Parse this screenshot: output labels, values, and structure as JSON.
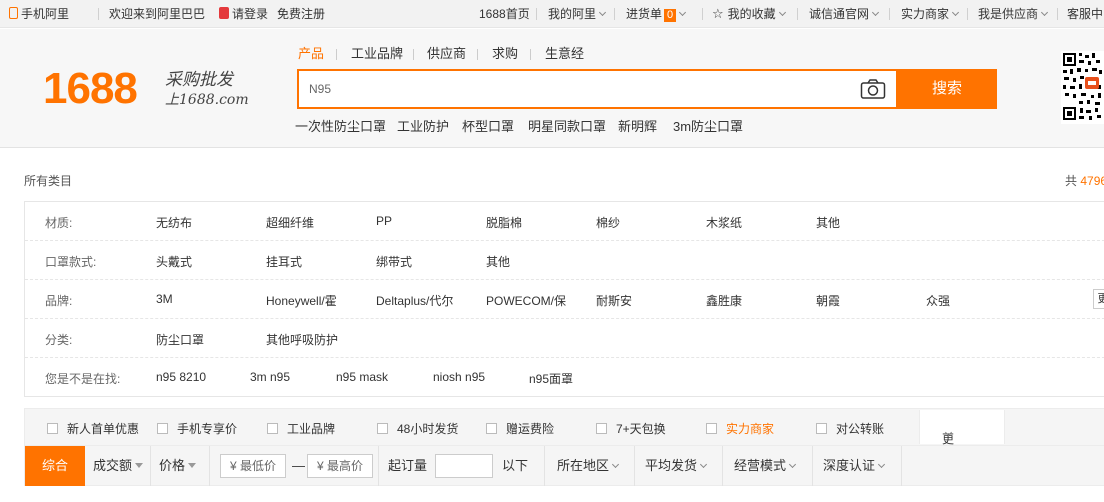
{
  "topbar": {
    "mobile": "手机阿里",
    "welcome": "欢迎来到阿里巴巴",
    "login": "请登录",
    "register": "免费注册",
    "home": "1688首页",
    "my_ali": "我的阿里",
    "cart": "进货单",
    "cart_count": "0",
    "favorites": "我的收藏",
    "chengxin": "诚信通官网",
    "power_merchant": "实力商家",
    "supplier": "我是供应商",
    "service": "客服中"
  },
  "logo": {
    "number": "1688",
    "slogan": "采购批发",
    "domain": "上1688.com"
  },
  "search": {
    "tabs": [
      "产品",
      "工业品牌",
      "供应商",
      "求购",
      "生意经"
    ],
    "value": "N95",
    "button": "搜索",
    "hot_keywords": [
      "一次性防尘口罩",
      "工业防护",
      "杯型口罩",
      "明星同款口罩",
      "新明辉",
      "3m防尘口罩"
    ]
  },
  "crumb": {
    "all": "所有类目",
    "total_prefix": "共",
    "total_num": "4796"
  },
  "filters": {
    "material": {
      "label": "材质:",
      "options": [
        "无纺布",
        "超细纤维",
        "PP",
        "脱脂棉",
        "棉纱",
        "木浆纸",
        "其他"
      ]
    },
    "style": {
      "label": "口罩款式:",
      "options": [
        "头戴式",
        "挂耳式",
        "绑带式",
        "其他"
      ]
    },
    "brand": {
      "label": "品牌:",
      "options": [
        "3M",
        "Honeywell/霍",
        "Deltaplus/代尔",
        "POWECOM/保",
        "耐斯安",
        "鑫胜康",
        "朝霞",
        "众强"
      ],
      "more": "更"
    },
    "category": {
      "label": "分类:",
      "options": [
        "防尘口罩",
        "其他呼吸防护"
      ]
    },
    "suggest": {
      "label": "您是不是在找:",
      "options": [
        "n95 8210",
        "3m n95",
        "n95 mask",
        "niosh n95",
        "n95面罩"
      ]
    }
  },
  "services": {
    "items": [
      "新人首单优惠",
      "手机专享价",
      "工业品牌",
      "48小时发货",
      "赠运费险",
      "7+天包换",
      "实力商家",
      "对公转账"
    ],
    "more": "更多",
    "highlight_color": "#ff7300"
  },
  "sort": {
    "comprehensive": "综合",
    "volume": "成交额",
    "price": "价格",
    "min_price": "¥ 最低价",
    "dash": "—",
    "max_price": "¥ 最高价",
    "moq": "起订量",
    "below": "以下",
    "location": "所在地区",
    "avg_ship": "平均发货",
    "biz_mode": "经营模式",
    "deep_cert": "深度认证"
  },
  "colors": {
    "accent": "#ff7300"
  }
}
